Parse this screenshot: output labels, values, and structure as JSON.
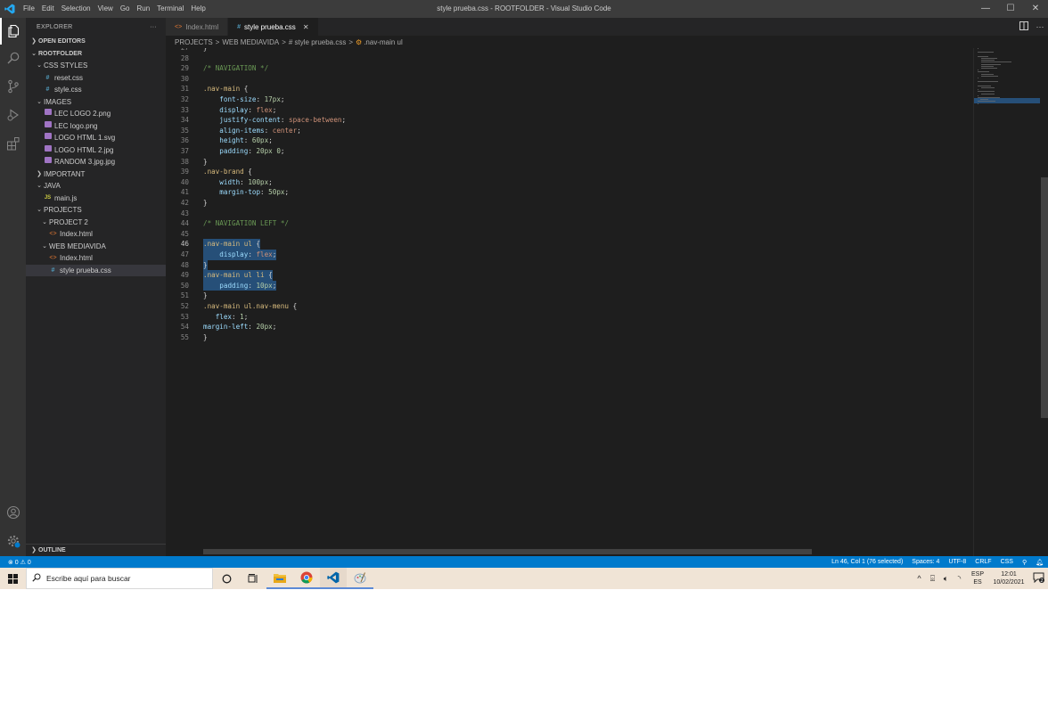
{
  "window": {
    "title": "style prueba.css - ROOTFOLDER - Visual Studio Code",
    "menu": [
      "File",
      "Edit",
      "Selection",
      "View",
      "Go",
      "Run",
      "Terminal",
      "Help"
    ],
    "controls": [
      "—",
      "☐",
      "✕"
    ]
  },
  "activity_bar": [
    "explorer-icon",
    "search-icon",
    "source-control-icon",
    "run-debug-icon",
    "extensions-icon",
    "account-icon",
    "settings-gear-icon"
  ],
  "sidebar": {
    "title": "EXPLORER",
    "more": "···",
    "sections": {
      "open_editors": "OPEN EDITORS",
      "root": "ROOTFOLDER",
      "outline": "OUTLINE"
    },
    "tree": [
      {
        "label": "CSS STYLES",
        "type": "folder",
        "open": true,
        "depth": 1
      },
      {
        "label": "reset.css",
        "type": "css",
        "depth": 2
      },
      {
        "label": "style.css",
        "type": "css",
        "depth": 2
      },
      {
        "label": "IMAGES",
        "type": "folder",
        "open": true,
        "depth": 1
      },
      {
        "label": "LEC LOGO 2.png",
        "type": "img",
        "depth": 2
      },
      {
        "label": "LEC logo.png",
        "type": "img",
        "depth": 2
      },
      {
        "label": "LOGO HTML 1.svg",
        "type": "img",
        "depth": 2
      },
      {
        "label": "LOGO HTML 2.jpg",
        "type": "img",
        "depth": 2
      },
      {
        "label": "RANDOM 3.jpg.jpg",
        "type": "img",
        "depth": 2
      },
      {
        "label": "IMPORTANT",
        "type": "folder",
        "open": false,
        "depth": 1
      },
      {
        "label": "JAVA",
        "type": "folder",
        "open": true,
        "depth": 1
      },
      {
        "label": "main.js",
        "type": "js",
        "depth": 2
      },
      {
        "label": "PROJECTS",
        "type": "folder",
        "open": true,
        "depth": 1
      },
      {
        "label": "PROJECT 2",
        "type": "folder",
        "open": true,
        "depth": 2
      },
      {
        "label": "Index.html",
        "type": "html",
        "depth": 3
      },
      {
        "label": "WEB MEDIAVIDA",
        "type": "folder",
        "open": true,
        "depth": 2
      },
      {
        "label": "Index.html",
        "type": "html",
        "depth": 3
      },
      {
        "label": "style prueba.css",
        "type": "css",
        "depth": 3,
        "selected": true
      }
    ]
  },
  "tabs": [
    {
      "label": "Index.html",
      "icon": "<>",
      "active": false
    },
    {
      "label": "style prueba.css",
      "icon": "#",
      "active": true,
      "close": "✕"
    }
  ],
  "breadcrumb": [
    "PROJECTS",
    "WEB MEDIAVIDA",
    "# style prueba.css",
    ".nav-main ul"
  ],
  "breadcrumb_sep": ">",
  "editor": {
    "current_line": 46,
    "lines": [
      {
        "n": "27",
        "tokens": [
          [
            "pun",
            "}"
          ]
        ]
      },
      {
        "n": "28",
        "tokens": []
      },
      {
        "n": "29",
        "tokens": [
          [
            "com",
            "/* NAVIGATION */"
          ]
        ]
      },
      {
        "n": "30",
        "tokens": []
      },
      {
        "n": "31",
        "tokens": [
          [
            "sel",
            ".nav-main"
          ],
          [
            "pun",
            " {"
          ]
        ]
      },
      {
        "n": "32",
        "tokens": [
          [
            "pun",
            "    "
          ],
          [
            "prop",
            "font-size"
          ],
          [
            "pun",
            ": "
          ],
          [
            "num",
            "17px"
          ],
          [
            "pun",
            ";"
          ]
        ]
      },
      {
        "n": "33",
        "tokens": [
          [
            "pun",
            "    "
          ],
          [
            "prop",
            "display"
          ],
          [
            "pun",
            ": "
          ],
          [
            "val",
            "flex"
          ],
          [
            "pun",
            ";"
          ]
        ]
      },
      {
        "n": "34",
        "tokens": [
          [
            "pun",
            "    "
          ],
          [
            "prop",
            "justify-content"
          ],
          [
            "pun",
            ": "
          ],
          [
            "val",
            "space-between"
          ],
          [
            "pun",
            ";"
          ]
        ]
      },
      {
        "n": "35",
        "tokens": [
          [
            "pun",
            "    "
          ],
          [
            "prop",
            "align-items"
          ],
          [
            "pun",
            ": "
          ],
          [
            "val",
            "center"
          ],
          [
            "pun",
            ";"
          ]
        ]
      },
      {
        "n": "36",
        "tokens": [
          [
            "pun",
            "    "
          ],
          [
            "prop",
            "height"
          ],
          [
            "pun",
            ": "
          ],
          [
            "num",
            "60px"
          ],
          [
            "pun",
            ";"
          ]
        ]
      },
      {
        "n": "37",
        "tokens": [
          [
            "pun",
            "    "
          ],
          [
            "prop",
            "padding"
          ],
          [
            "pun",
            ": "
          ],
          [
            "num",
            "20px 0"
          ],
          [
            "pun",
            ";"
          ]
        ]
      },
      {
        "n": "38",
        "tokens": [
          [
            "pun",
            "}"
          ]
        ]
      },
      {
        "n": "39",
        "tokens": [
          [
            "sel",
            ".nav-brand"
          ],
          [
            "pun",
            " {"
          ]
        ]
      },
      {
        "n": "40",
        "tokens": [
          [
            "pun",
            "    "
          ],
          [
            "prop",
            "width"
          ],
          [
            "pun",
            ": "
          ],
          [
            "num",
            "100px"
          ],
          [
            "pun",
            ";"
          ]
        ]
      },
      {
        "n": "41",
        "tokens": [
          [
            "pun",
            "    "
          ],
          [
            "prop",
            "margin-top"
          ],
          [
            "pun",
            ": "
          ],
          [
            "num",
            "50px"
          ],
          [
            "pun",
            ";"
          ]
        ]
      },
      {
        "n": "42",
        "tokens": [
          [
            "pun",
            "}"
          ]
        ]
      },
      {
        "n": "43",
        "tokens": []
      },
      {
        "n": "44",
        "tokens": [
          [
            "com",
            "/* NAVIGATION LEFT */"
          ]
        ]
      },
      {
        "n": "45",
        "tokens": []
      },
      {
        "n": "46",
        "selected": true,
        "tokens": [
          [
            "sel",
            ".nav-main ul"
          ],
          [
            "pun",
            " {"
          ]
        ]
      },
      {
        "n": "47",
        "selected": true,
        "tokens": [
          [
            "pun",
            "    "
          ],
          [
            "prop",
            "display"
          ],
          [
            "pun",
            ": "
          ],
          [
            "val",
            "flex"
          ],
          [
            "pun",
            ";"
          ]
        ]
      },
      {
        "n": "48",
        "selected": true,
        "tokens": [
          [
            "pun",
            "}"
          ]
        ]
      },
      {
        "n": "49",
        "selected": true,
        "tokens": [
          [
            "sel",
            ".nav-main ul li"
          ],
          [
            "pun",
            " {"
          ]
        ]
      },
      {
        "n": "50",
        "selected": true,
        "tokens": [
          [
            "pun",
            "    "
          ],
          [
            "prop",
            "padding"
          ],
          [
            "pun",
            ": "
          ],
          [
            "num",
            "10px"
          ],
          [
            "pun",
            ";"
          ]
        ]
      },
      {
        "n": "51",
        "tokens": [
          [
            "pun",
            "}"
          ]
        ]
      },
      {
        "n": "52",
        "tokens": [
          [
            "sel",
            ".nav-main ul.nav-menu"
          ],
          [
            "pun",
            " {"
          ]
        ]
      },
      {
        "n": "53",
        "tokens": [
          [
            "pun",
            "   "
          ],
          [
            "prop",
            "flex"
          ],
          [
            "pun",
            ": "
          ],
          [
            "num",
            "1"
          ],
          [
            "pun",
            ";"
          ]
        ]
      },
      {
        "n": "54",
        "tokens": [
          [
            "prop",
            "margin-left"
          ],
          [
            "pun",
            ": "
          ],
          [
            "num",
            "20px"
          ],
          [
            "pun",
            ";"
          ]
        ]
      },
      {
        "n": "55",
        "tokens": [
          [
            "pun",
            "}"
          ]
        ]
      }
    ]
  },
  "status": {
    "problems": "⊗ 0 ⚠ 0",
    "position": "Ln 46, Col 1 (76 selected)",
    "spaces": "Spaces: 4",
    "encoding": "UTF-8",
    "eol": "CRLF",
    "language": "CSS"
  },
  "taskbar": {
    "search_placeholder": "Escribe aquí para buscar",
    "apps": [
      "cortana-icon",
      "task-view-icon",
      "file-explorer-icon",
      "chrome-icon",
      "vscode-icon",
      "paint-icon"
    ],
    "tray": {
      "lang_top": "ESP",
      "lang_bottom": "ES",
      "time": "12:01",
      "date": "10/02/2021",
      "notifications": "2"
    }
  },
  "colors": {
    "accent": "#007acc",
    "selection": "#264f78",
    "editor_bg": "#1e1e1e",
    "sidebar_bg": "#252526"
  }
}
